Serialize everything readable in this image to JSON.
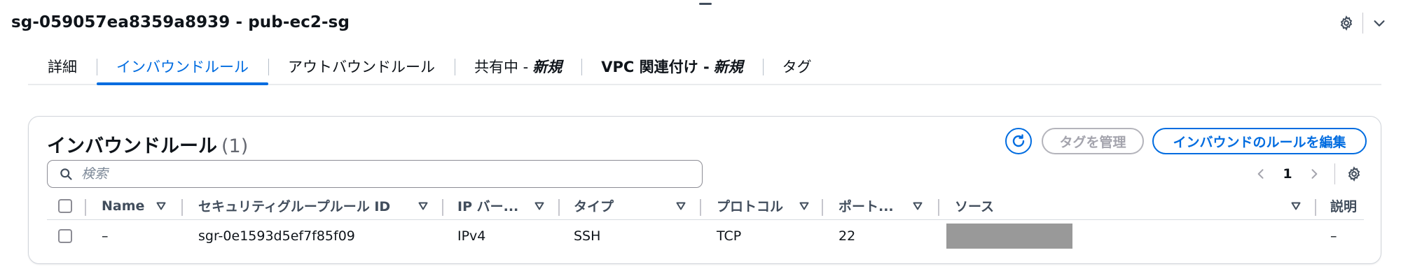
{
  "header": {
    "title": "sg-059057ea8359a8939 - pub-ec2-sg"
  },
  "tabs": [
    {
      "label": "詳細"
    },
    {
      "label": "インバウンドルール",
      "active": true
    },
    {
      "label": "アウトバウンドルール"
    },
    {
      "label": "共有中 -",
      "suffix": "新規"
    },
    {
      "label": "VPC 関連付け -",
      "suffix": "新規"
    },
    {
      "label": "タグ"
    }
  ],
  "panel": {
    "title": "インバウンドルール",
    "count": "(1)",
    "manage_tags_label": "タグを管理",
    "edit_rules_label": "インバウンドのルールを編集",
    "search": {
      "placeholder": "検索",
      "value": ""
    },
    "pagination": {
      "current_page": "1"
    }
  },
  "table": {
    "columns": [
      "Name",
      "セキュリティグループルール ID",
      "IP バー...",
      "タイプ",
      "プロトコル",
      "ポート...",
      "ソース",
      "説明"
    ],
    "rows": [
      {
        "name": "–",
        "rule_id": "sgr-0e1593d5ef7f85f09",
        "ip_version": "IPv4",
        "type": "SSH",
        "protocol": "TCP",
        "port": "22",
        "source": "",
        "description": "–"
      }
    ]
  },
  "colors": {
    "accent": "#006ce0",
    "text": "#0f141a",
    "header_text": "#414d5c",
    "border": "#d1d5db",
    "disabled": "#a4a4ad",
    "redacted": "#999999"
  },
  "icons": {
    "header_settings": "gear-icon",
    "header_collapse": "chevron-down-icon",
    "refresh": "refresh-icon",
    "search": "search-icon",
    "prev": "chevron-left-icon",
    "next": "chevron-right-icon",
    "table_settings": "gear-icon",
    "sort": "caret-down-icon"
  }
}
